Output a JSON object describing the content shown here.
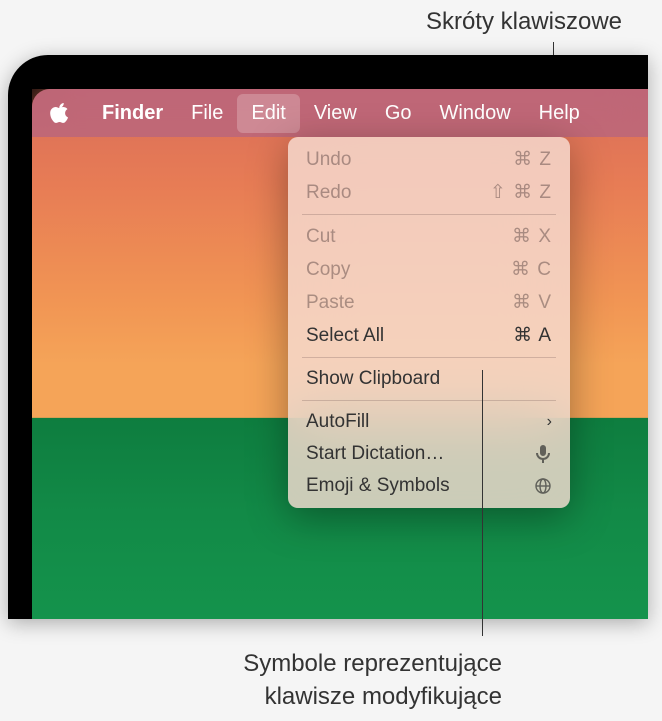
{
  "callouts": {
    "top": "Skróty klawiszowe",
    "bottom_line1": "Symbole reprezentujące",
    "bottom_line2": "klawisze modyfikujące"
  },
  "menubar": {
    "app": "Finder",
    "items": [
      "File",
      "Edit",
      "View",
      "Go",
      "Window",
      "Help"
    ],
    "active": "Edit"
  },
  "dropdown": {
    "groups": [
      [
        {
          "label": "Undo",
          "shortcut": "⌘ Z",
          "disabled": true
        },
        {
          "label": "Redo",
          "shortcut": "⇧ ⌘ Z",
          "disabled": true
        }
      ],
      [
        {
          "label": "Cut",
          "shortcut": "⌘ X",
          "disabled": true
        },
        {
          "label": "Copy",
          "shortcut": "⌘ C",
          "disabled": true
        },
        {
          "label": "Paste",
          "shortcut": "⌘ V",
          "disabled": true
        },
        {
          "label": "Select All",
          "shortcut": "⌘ A",
          "disabled": false
        }
      ],
      [
        {
          "label": "Show Clipboard",
          "shortcut": "",
          "disabled": false
        }
      ],
      [
        {
          "label": "AutoFill",
          "icon": "chevron",
          "disabled": false
        },
        {
          "label": "Start Dictation…",
          "icon": "mic",
          "disabled": false
        },
        {
          "label": "Emoji & Symbols",
          "icon": "globe",
          "disabled": false
        }
      ]
    ]
  }
}
